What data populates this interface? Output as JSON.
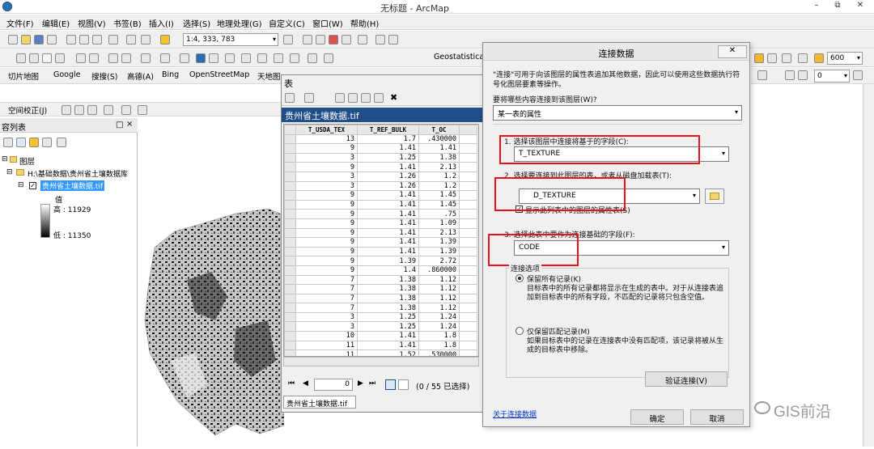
{
  "window": {
    "title": "无标题 - ArcMap",
    "min": "–",
    "max": "⧉",
    "close": "✕"
  },
  "menu": [
    "文件(F)",
    "编辑(E)",
    "视图(V)",
    "书签(B)",
    "插入(I)",
    "选择(S)",
    "地理处理(G)",
    "自定义(C)",
    "窗口(W)",
    "帮助(H)"
  ],
  "toolbar": {
    "scale": "1:4, 333, 783",
    "geostat": "Geostatistica",
    "row3": [
      "切片地图",
      "Google",
      "搜搜(S)",
      "高德(A)",
      "Bing",
      "OpenStreetMap",
      "天地图"
    ],
    "georef": "空间校正(J)",
    "spin1": "600",
    "spin2": "0"
  },
  "toc": {
    "title": "容列表",
    "pin": "□",
    "close": "×",
    "layers_root": "图层",
    "folder": "H:\\基础数据\\贵州省土壤数据库",
    "layer": "贵州省土壤数据.tif",
    "value_label": "值",
    "high": "高 : 11929",
    "low": "低 : 11350"
  },
  "table_window": {
    "title": "表",
    "layer_tab": "贵州省土壤数据.tif",
    "headers": [
      "T_USDA_TEX",
      "T_REF_BULK",
      "T_OC"
    ],
    "rows": [
      [
        "13",
        "1.7",
        ".430000"
      ],
      [
        "9",
        "1.41",
        "1.41"
      ],
      [
        "3",
        "1.25",
        "1.38"
      ],
      [
        "9",
        "1.41",
        "2.13"
      ],
      [
        "3",
        "1.26",
        "1.2"
      ],
      [
        "3",
        "1.26",
        "1.2"
      ],
      [
        "9",
        "1.41",
        "1.45"
      ],
      [
        "9",
        "1.41",
        "1.45"
      ],
      [
        "9",
        "1.41",
        ".75"
      ],
      [
        "9",
        "1.41",
        "1.09"
      ],
      [
        "9",
        "1.41",
        "2.13"
      ],
      [
        "9",
        "1.41",
        "1.39"
      ],
      [
        "9",
        "1.41",
        "1.39"
      ],
      [
        "9",
        "1.39",
        "2.72"
      ],
      [
        "9",
        "1.4",
        ".860000"
      ],
      [
        "7",
        "1.38",
        "1.12"
      ],
      [
        "7",
        "1.38",
        "1.12"
      ],
      [
        "7",
        "1.38",
        "1.12"
      ],
      [
        "7",
        "1.38",
        "1.12"
      ],
      [
        "3",
        "1.25",
        "1.24"
      ],
      [
        "3",
        "1.25",
        "1.24"
      ],
      [
        "10",
        "1.41",
        "1.8"
      ],
      [
        "11",
        "1.41",
        "1.8"
      ],
      [
        "11",
        "1.52",
        ".530000"
      ]
    ],
    "nav_record": "0",
    "selection": "(0 / 55 已选择)",
    "bottom_tab": "贵州省土壤数据.tif"
  },
  "dialog": {
    "title": "连接数据",
    "close": "✕",
    "intro": "\"连接\"可用于向该图层的属性表追加其他数据，因此可以使用这些数据执行符号化图层要素等操作。",
    "what_label": "要将哪些内容连接到该图层(W)?",
    "what_value": "某一表的属性",
    "step1_label": "1. 选择该图层中连接将基于的字段(C):",
    "step1_value": "T_TEXTURE",
    "step2_label": "2. 选择要连接到此图层的表，或者从磁盘加载表(T):",
    "step2_value": "D_TEXTURE",
    "step2_check": "显示此列表中的图层的属性表(S)",
    "step3_label": "3. 选择此表中要作为连接基础的字段(F):",
    "step3_value": "CODE",
    "options_label": "连接选项",
    "opt1_label": "保留所有记录(K)",
    "opt1_desc": "目标表中的所有记录都将显示在生成的表中。对于从连接表追加到目标表中的所有字段，不匹配的记录将只包含空值。",
    "opt2_label": "仅保留匹配记录(M)",
    "opt2_desc": "如果目标表中的记录在连接表中没有匹配项，该记录将被从生成的目标表中移除。",
    "validate": "验证连接(V)",
    "link": "关于连接数据",
    "ok": "确定",
    "cancel": "取消"
  },
  "watermark": "GIS前沿",
  "colors": {
    "highlight_red": "#e8101a",
    "selected_blue": "#3399ff",
    "tab_blue": "#1f4e8a",
    "link_blue": "#0033cc"
  }
}
